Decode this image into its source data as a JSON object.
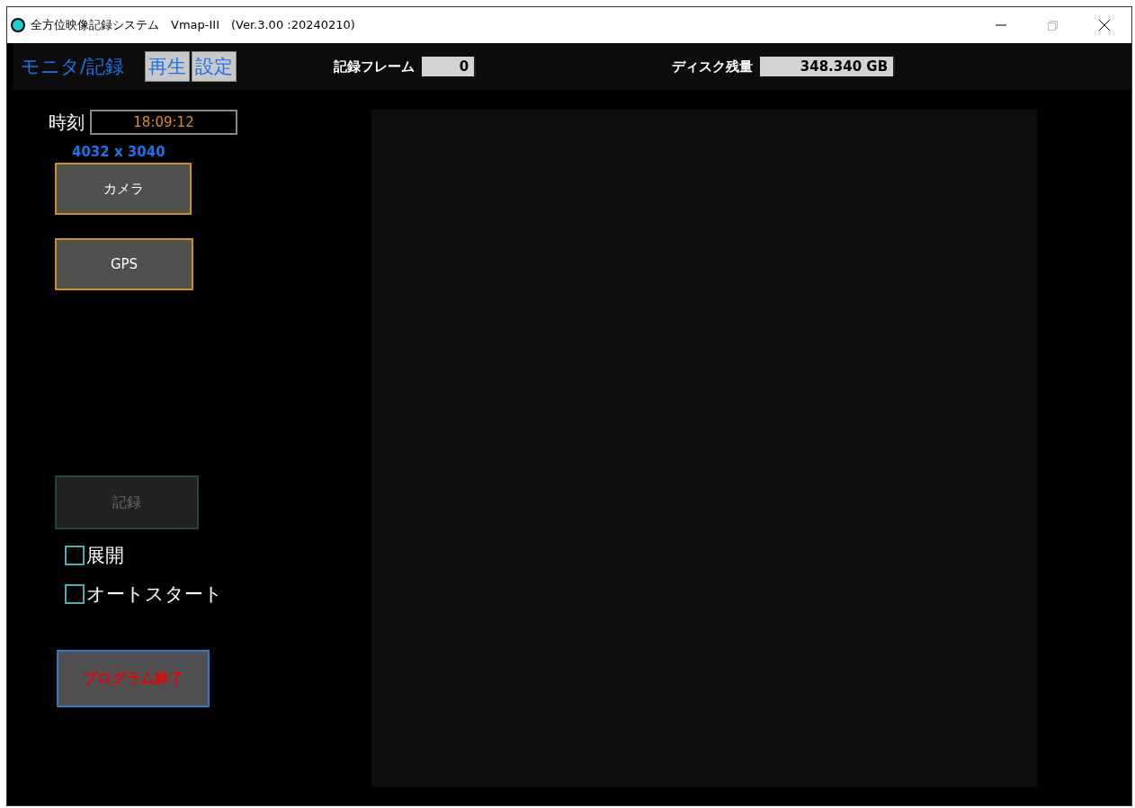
{
  "window": {
    "title": "全方位映像記録システム　Vmap-III　(Ver.3.00 :20240210)"
  },
  "tabs": [
    {
      "label": "モニタ/記録",
      "selected": true
    },
    {
      "label": "再生",
      "selected": false
    },
    {
      "label": "設定",
      "selected": false
    }
  ],
  "header_fields": [
    {
      "label": "記録フレーム",
      "value": "0"
    },
    {
      "label": "ディスク残量",
      "value": "348.340 GB"
    }
  ],
  "time": {
    "label": "時刻",
    "value": "18:09:12"
  },
  "resolution": "4032 x 3040",
  "device_buttons": [
    "カメラ",
    "GPS"
  ],
  "record_button": {
    "label": "記録",
    "disabled": true
  },
  "checkboxes": [
    {
      "label": "展開",
      "checked": false
    },
    {
      "label": "オートスタート",
      "checked": false
    }
  ],
  "exit_button": "プログラム終了"
}
